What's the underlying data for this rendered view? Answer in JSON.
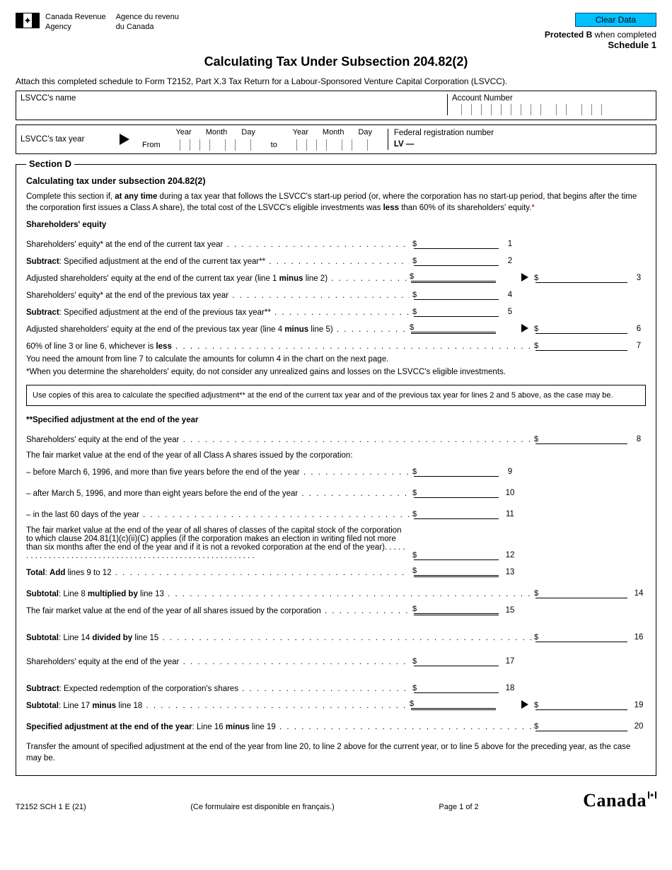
{
  "header": {
    "agency_en_l1": "Canada Revenue",
    "agency_en_l2": "Agency",
    "agency_fr_l1": "Agence du revenu",
    "agency_fr_l2": "du Canada",
    "clear_data": "Clear Data",
    "protected_prefix": "Protected B",
    "protected_suffix": " when completed",
    "schedule": "Schedule 1",
    "title": "Calculating Tax Under Subsection 204.82(2)",
    "attach": "Attach this completed schedule to Form T2152, Part X.3 Tax Return for a Labour-Sponsored Venture Capital Corporation (LSVCC)."
  },
  "fields": {
    "lsvcc_name": "LSVCC's name",
    "account_number": "Account Number",
    "tax_year": "LSVCC's tax year",
    "year": "Year",
    "month": "Month",
    "day": "Day",
    "from": "From",
    "to": "to",
    "fed_reg": "Federal registration number",
    "lv": "LV —"
  },
  "section": {
    "legend": "Section D",
    "heading": "Calculating tax under subsection 204.82(2)",
    "intro_a": "Complete this section if, ",
    "intro_b": "at any time",
    "intro_c": " during a tax year that follows the LSVCC's start-up period (or, where the corporation has no start-up period, that begins after the time the corporation first issues a Class A share), the total cost of the LSVCC's eligible investments was ",
    "intro_d": "less",
    "intro_e": " than 60% of its shareholders' equity.",
    "shareholders_equity_head": "Shareholders' equity",
    "copies_box": "Use copies of this area to calculate the specified adjustment** at the end of the current tax year and of the previous tax year for lines 2 and 5 above, as the case may be.",
    "specified_head": "**Specified adjustment at the end of the year",
    "transfer": "Transfer the amount of specified adjustment at the end of the year from line 20, to line 2 above for the current year, or to line 5 above for the preceding year, as the case may be."
  },
  "lines": {
    "l1": "Shareholders' equity* at the end of the current tax year",
    "l2a": "Subtract",
    "l2b": ": Specified adjustment at the end of the current tax year**",
    "l3a": "Adjusted shareholders' equity at the end of the current tax year (line 1 ",
    "l3b": "minus",
    "l3c": " line 2)",
    "l4": "Shareholders' equity* at the end of the previous tax year",
    "l5a": "Subtract",
    "l5b": ": Specified adjustment at the end of the previous tax year**",
    "l6a": "Adjusted shareholders' equity at the end of the previous tax year (line 4 ",
    "l6b": "minus",
    "l6c": " line 5)",
    "l7a": "60% of line 3 or line 6, whichever is ",
    "l7b": "less",
    "note_after7": "You need the amount from line 7 to calculate the amounts for column 4 in the chart on the next page.",
    "star_note": "*When you determine the shareholders' equity, do not consider any unrealized gains and losses on the LSVCC's eligible investments.",
    "l8": "Shareholders' equity at the end of the year",
    "fmv_intro": "The fair market value at the end of the year of all Class A shares issued by the corporation:",
    "l9": "– before March 6, 1996, and more than five years before the end of the year",
    "l10": "– after March 5, 1996, and more than eight years before the end of the year",
    "l11": "– in the last 60 days of the year",
    "l12": "The fair market value at the end of the year of all shares of classes of the capital stock of the corporation to which clause 204.81(1)(c)(ii)(C) applies (if the corporation makes an election in writing filed not more than six months after the end of the year and if it is not a revoked corporation at the end of the year).",
    "l13a": "Total",
    "l13b": ": ",
    "l13c": "Add",
    "l13d": " lines 9 to 12",
    "l14a": "Subtotal",
    "l14b": ": Line 8 ",
    "l14c": "multiplied by",
    "l14d": " line 13",
    "l15": "The fair market value at the end of the year of all shares issued by the corporation",
    "l16a": "Subtotal",
    "l16b": ": Line 14 ",
    "l16c": "divided by",
    "l16d": " line 15",
    "l17": "Shareholders' equity at the end of the year",
    "l18a": "Subtract",
    "l18b": ": Expected redemption of the corporation's shares",
    "l19a": "Subtotal",
    "l19b": ": Line 17 ",
    "l19c": "minus",
    "l19d": " line 18",
    "l20a": "Specified adjustment at the end of the year",
    "l20b": ": Line 16 ",
    "l20c": "minus",
    "l20d": " line 19"
  },
  "nums": {
    "n1": "1",
    "n2": "2",
    "n3": "3",
    "n4": "4",
    "n5": "5",
    "n6": "6",
    "n7": "7",
    "n8": "8",
    "n9": "9",
    "n10": "10",
    "n11": "11",
    "n12": "12",
    "n13": "13",
    "n14": "14",
    "n15": "15",
    "n16": "16",
    "n17": "17",
    "n18": "18",
    "n19": "19",
    "n20": "20"
  },
  "footer": {
    "form_id": "T2152 SCH 1 E (21)",
    "fr_note": "(Ce formulaire est disponible en français.)",
    "page": "Page 1 of 2",
    "wordmark": "Canada"
  }
}
